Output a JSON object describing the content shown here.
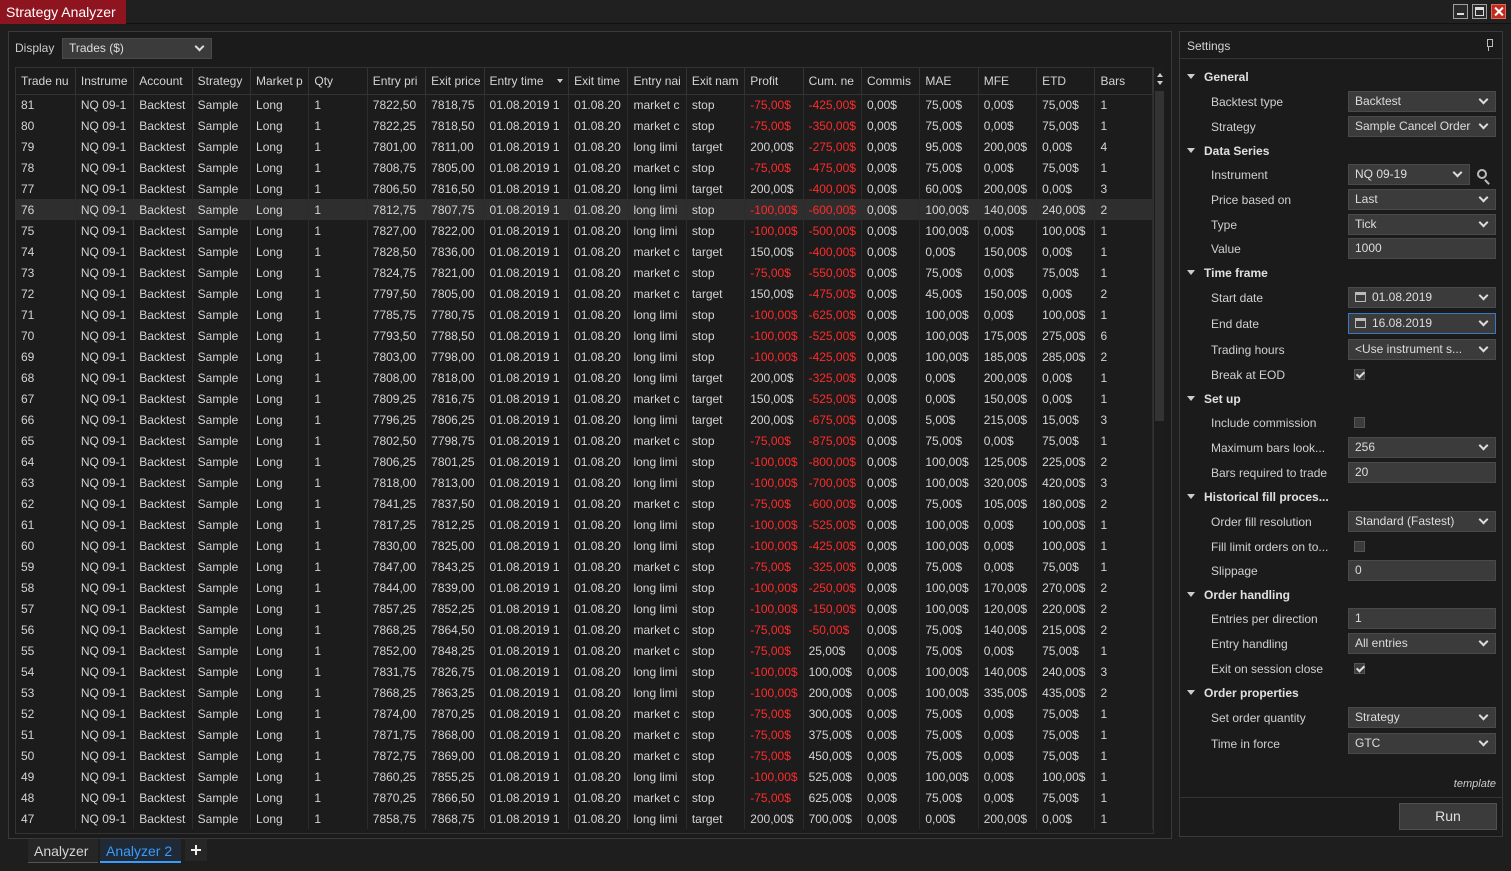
{
  "window": {
    "title": "Strategy Analyzer"
  },
  "toolbar": {
    "display_label": "Display",
    "display_value": "Trades ($)"
  },
  "grid": {
    "columns": [
      "Trade nu",
      "Instrume",
      "Account",
      "Strategy",
      "Market p",
      "Qty",
      "Entry pri",
      "Exit price",
      "Entry time",
      "Exit time",
      "Entry nai",
      "Exit nam",
      "Profit",
      "Cum. ne",
      "Commis",
      "MAE",
      "MFE",
      "ETD",
      "Bars"
    ],
    "rows": [
      [
        "81",
        "NQ 09-1",
        "Backtest",
        "Sample",
        "Long",
        "1",
        "7822,50",
        "7818,75",
        "01.08.2019 1",
        "01.08.20",
        "market c",
        "stop",
        "-75,00$",
        "-425,00$",
        "0,00$",
        "75,00$",
        "0,00$",
        "75,00$",
        "1"
      ],
      [
        "80",
        "NQ 09-1",
        "Backtest",
        "Sample",
        "Long",
        "1",
        "7822,25",
        "7818,50",
        "01.08.2019 1",
        "01.08.20",
        "market c",
        "stop",
        "-75,00$",
        "-350,00$",
        "0,00$",
        "75,00$",
        "0,00$",
        "75,00$",
        "1"
      ],
      [
        "79",
        "NQ 09-1",
        "Backtest",
        "Sample",
        "Long",
        "1",
        "7801,00",
        "7811,00",
        "01.08.2019 1",
        "01.08.20",
        "long limi",
        "target",
        "200,00$",
        "-275,00$",
        "0,00$",
        "95,00$",
        "200,00$",
        "0,00$",
        "4"
      ],
      [
        "78",
        "NQ 09-1",
        "Backtest",
        "Sample",
        "Long",
        "1",
        "7808,75",
        "7805,00",
        "01.08.2019 1",
        "01.08.20",
        "market c",
        "stop",
        "-75,00$",
        "-475,00$",
        "0,00$",
        "75,00$",
        "0,00$",
        "75,00$",
        "1"
      ],
      [
        "77",
        "NQ 09-1",
        "Backtest",
        "Sample",
        "Long",
        "1",
        "7806,50",
        "7816,50",
        "01.08.2019 1",
        "01.08.20",
        "long limi",
        "target",
        "200,00$",
        "-400,00$",
        "0,00$",
        "60,00$",
        "200,00$",
        "0,00$",
        "3"
      ],
      [
        "76",
        "NQ 09-1",
        "Backtest",
        "Sample",
        "Long",
        "1",
        "7812,75",
        "7807,75",
        "01.08.2019 1",
        "01.08.20",
        "long limi",
        "stop",
        "-100,00$",
        "-600,00$",
        "0,00$",
        "100,00$",
        "140,00$",
        "240,00$",
        "2"
      ],
      [
        "75",
        "NQ 09-1",
        "Backtest",
        "Sample",
        "Long",
        "1",
        "7827,00",
        "7822,00",
        "01.08.2019 1",
        "01.08.20",
        "long limi",
        "stop",
        "-100,00$",
        "-500,00$",
        "0,00$",
        "100,00$",
        "0,00$",
        "100,00$",
        "1"
      ],
      [
        "74",
        "NQ 09-1",
        "Backtest",
        "Sample",
        "Long",
        "1",
        "7828,50",
        "7836,00",
        "01.08.2019 1",
        "01.08.20",
        "market c",
        "target",
        "150,00$",
        "-400,00$",
        "0,00$",
        "0,00$",
        "150,00$",
        "0,00$",
        "1"
      ],
      [
        "73",
        "NQ 09-1",
        "Backtest",
        "Sample",
        "Long",
        "1",
        "7824,75",
        "7821,00",
        "01.08.2019 1",
        "01.08.20",
        "market c",
        "stop",
        "-75,00$",
        "-550,00$",
        "0,00$",
        "75,00$",
        "0,00$",
        "75,00$",
        "1"
      ],
      [
        "72",
        "NQ 09-1",
        "Backtest",
        "Sample",
        "Long",
        "1",
        "7797,50",
        "7805,00",
        "01.08.2019 1",
        "01.08.20",
        "market c",
        "target",
        "150,00$",
        "-475,00$",
        "0,00$",
        "45,00$",
        "150,00$",
        "0,00$",
        "2"
      ],
      [
        "71",
        "NQ 09-1",
        "Backtest",
        "Sample",
        "Long",
        "1",
        "7785,75",
        "7780,75",
        "01.08.2019 1",
        "01.08.20",
        "long limi",
        "stop",
        "-100,00$",
        "-625,00$",
        "0,00$",
        "100,00$",
        "0,00$",
        "100,00$",
        "1"
      ],
      [
        "70",
        "NQ 09-1",
        "Backtest",
        "Sample",
        "Long",
        "1",
        "7793,50",
        "7788,50",
        "01.08.2019 1",
        "01.08.20",
        "long limi",
        "stop",
        "-100,00$",
        "-525,00$",
        "0,00$",
        "100,00$",
        "175,00$",
        "275,00$",
        "6"
      ],
      [
        "69",
        "NQ 09-1",
        "Backtest",
        "Sample",
        "Long",
        "1",
        "7803,00",
        "7798,00",
        "01.08.2019 1",
        "01.08.20",
        "long limi",
        "stop",
        "-100,00$",
        "-425,00$",
        "0,00$",
        "100,00$",
        "185,00$",
        "285,00$",
        "2"
      ],
      [
        "68",
        "NQ 09-1",
        "Backtest",
        "Sample",
        "Long",
        "1",
        "7808,00",
        "7818,00",
        "01.08.2019 1",
        "01.08.20",
        "long limi",
        "target",
        "200,00$",
        "-325,00$",
        "0,00$",
        "0,00$",
        "200,00$",
        "0,00$",
        "1"
      ],
      [
        "67",
        "NQ 09-1",
        "Backtest",
        "Sample",
        "Long",
        "1",
        "7809,25",
        "7816,75",
        "01.08.2019 1",
        "01.08.20",
        "market c",
        "target",
        "150,00$",
        "-525,00$",
        "0,00$",
        "0,00$",
        "150,00$",
        "0,00$",
        "1"
      ],
      [
        "66",
        "NQ 09-1",
        "Backtest",
        "Sample",
        "Long",
        "1",
        "7796,25",
        "7806,25",
        "01.08.2019 1",
        "01.08.20",
        "long limi",
        "target",
        "200,00$",
        "-675,00$",
        "0,00$",
        "5,00$",
        "215,00$",
        "15,00$",
        "3"
      ],
      [
        "65",
        "NQ 09-1",
        "Backtest",
        "Sample",
        "Long",
        "1",
        "7802,50",
        "7798,75",
        "01.08.2019 1",
        "01.08.20",
        "market c",
        "stop",
        "-75,00$",
        "-875,00$",
        "0,00$",
        "75,00$",
        "0,00$",
        "75,00$",
        "1"
      ],
      [
        "64",
        "NQ 09-1",
        "Backtest",
        "Sample",
        "Long",
        "1",
        "7806,25",
        "7801,25",
        "01.08.2019 1",
        "01.08.20",
        "long limi",
        "stop",
        "-100,00$",
        "-800,00$",
        "0,00$",
        "100,00$",
        "125,00$",
        "225,00$",
        "2"
      ],
      [
        "63",
        "NQ 09-1",
        "Backtest",
        "Sample",
        "Long",
        "1",
        "7818,00",
        "7813,00",
        "01.08.2019 1",
        "01.08.20",
        "long limi",
        "stop",
        "-100,00$",
        "-700,00$",
        "0,00$",
        "100,00$",
        "320,00$",
        "420,00$",
        "3"
      ],
      [
        "62",
        "NQ 09-1",
        "Backtest",
        "Sample",
        "Long",
        "1",
        "7841,25",
        "7837,50",
        "01.08.2019 1",
        "01.08.20",
        "market c",
        "stop",
        "-75,00$",
        "-600,00$",
        "0,00$",
        "75,00$",
        "105,00$",
        "180,00$",
        "2"
      ],
      [
        "61",
        "NQ 09-1",
        "Backtest",
        "Sample",
        "Long",
        "1",
        "7817,25",
        "7812,25",
        "01.08.2019 1",
        "01.08.20",
        "long limi",
        "stop",
        "-100,00$",
        "-525,00$",
        "0,00$",
        "100,00$",
        "0,00$",
        "100,00$",
        "1"
      ],
      [
        "60",
        "NQ 09-1",
        "Backtest",
        "Sample",
        "Long",
        "1",
        "7830,00",
        "7825,00",
        "01.08.2019 1",
        "01.08.20",
        "long limi",
        "stop",
        "-100,00$",
        "-425,00$",
        "0,00$",
        "100,00$",
        "0,00$",
        "100,00$",
        "1"
      ],
      [
        "59",
        "NQ 09-1",
        "Backtest",
        "Sample",
        "Long",
        "1",
        "7847,00",
        "7843,25",
        "01.08.2019 1",
        "01.08.20",
        "market c",
        "stop",
        "-75,00$",
        "-325,00$",
        "0,00$",
        "75,00$",
        "0,00$",
        "75,00$",
        "1"
      ],
      [
        "58",
        "NQ 09-1",
        "Backtest",
        "Sample",
        "Long",
        "1",
        "7844,00",
        "7839,00",
        "01.08.2019 1",
        "01.08.20",
        "long limi",
        "stop",
        "-100,00$",
        "-250,00$",
        "0,00$",
        "100,00$",
        "170,00$",
        "270,00$",
        "2"
      ],
      [
        "57",
        "NQ 09-1",
        "Backtest",
        "Sample",
        "Long",
        "1",
        "7857,25",
        "7852,25",
        "01.08.2019 1",
        "01.08.20",
        "long limi",
        "stop",
        "-100,00$",
        "-150,00$",
        "0,00$",
        "100,00$",
        "120,00$",
        "220,00$",
        "2"
      ],
      [
        "56",
        "NQ 09-1",
        "Backtest",
        "Sample",
        "Long",
        "1",
        "7868,25",
        "7864,50",
        "01.08.2019 1",
        "01.08.20",
        "market c",
        "stop",
        "-75,00$",
        "-50,00$",
        "0,00$",
        "75,00$",
        "140,00$",
        "215,00$",
        "2"
      ],
      [
        "55",
        "NQ 09-1",
        "Backtest",
        "Sample",
        "Long",
        "1",
        "7852,00",
        "7848,25",
        "01.08.2019 1",
        "01.08.20",
        "market c",
        "stop",
        "-75,00$",
        "25,00$",
        "0,00$",
        "75,00$",
        "0,00$",
        "75,00$",
        "1"
      ],
      [
        "54",
        "NQ 09-1",
        "Backtest",
        "Sample",
        "Long",
        "1",
        "7831,75",
        "7826,75",
        "01.08.2019 1",
        "01.08.20",
        "long limi",
        "stop",
        "-100,00$",
        "100,00$",
        "0,00$",
        "100,00$",
        "140,00$",
        "240,00$",
        "3"
      ],
      [
        "53",
        "NQ 09-1",
        "Backtest",
        "Sample",
        "Long",
        "1",
        "7868,25",
        "7863,25",
        "01.08.2019 1",
        "01.08.20",
        "long limi",
        "stop",
        "-100,00$",
        "200,00$",
        "0,00$",
        "100,00$",
        "335,00$",
        "435,00$",
        "2"
      ],
      [
        "52",
        "NQ 09-1",
        "Backtest",
        "Sample",
        "Long",
        "1",
        "7874,00",
        "7870,25",
        "01.08.2019 1",
        "01.08.20",
        "market c",
        "stop",
        "-75,00$",
        "300,00$",
        "0,00$",
        "75,00$",
        "0,00$",
        "75,00$",
        "1"
      ],
      [
        "51",
        "NQ 09-1",
        "Backtest",
        "Sample",
        "Long",
        "1",
        "7871,75",
        "7868,00",
        "01.08.2019 1",
        "01.08.20",
        "market c",
        "stop",
        "-75,00$",
        "375,00$",
        "0,00$",
        "75,00$",
        "0,00$",
        "75,00$",
        "1"
      ],
      [
        "50",
        "NQ 09-1",
        "Backtest",
        "Sample",
        "Long",
        "1",
        "7872,75",
        "7869,00",
        "01.08.2019 1",
        "01.08.20",
        "market c",
        "stop",
        "-75,00$",
        "450,00$",
        "0,00$",
        "75,00$",
        "0,00$",
        "75,00$",
        "1"
      ],
      [
        "49",
        "NQ 09-1",
        "Backtest",
        "Sample",
        "Long",
        "1",
        "7860,25",
        "7855,25",
        "01.08.2019 1",
        "01.08.20",
        "long limi",
        "stop",
        "-100,00$",
        "525,00$",
        "0,00$",
        "100,00$",
        "0,00$",
        "100,00$",
        "1"
      ],
      [
        "48",
        "NQ 09-1",
        "Backtest",
        "Sample",
        "Long",
        "1",
        "7870,25",
        "7866,50",
        "01.08.2019 1",
        "01.08.20",
        "market c",
        "stop",
        "-75,00$",
        "625,00$",
        "0,00$",
        "75,00$",
        "0,00$",
        "75,00$",
        "1"
      ],
      [
        "47",
        "NQ 09-1",
        "Backtest",
        "Sample",
        "Long",
        "1",
        "7858,75",
        "7868,75",
        "01.08.2019 1",
        "01.08.20",
        "long limi",
        "target",
        "200,00$",
        "700,00$",
        "0,00$",
        "0,00$",
        "200,00$",
        "0,00$",
        "1"
      ]
    ]
  },
  "settings": {
    "title": "Settings",
    "categories": {
      "general": "General",
      "data_series": "Data Series",
      "time_frame": "Time frame",
      "setup": "Set up",
      "historical": "Historical fill proces...",
      "order_handling": "Order handling",
      "order_properties": "Order properties"
    },
    "labels": {
      "backtest_type": "Backtest type",
      "strategy": "Strategy",
      "instrument": "Instrument",
      "price_based_on": "Price based on",
      "type": "Type",
      "value": "Value",
      "start_date": "Start date",
      "end_date": "End date",
      "trading_hours": "Trading hours",
      "break_at_eod": "Break at EOD",
      "include_commission": "Include commission",
      "max_bars_lookback": "Maximum bars look...",
      "bars_required": "Bars required to trade",
      "order_fill_resolution": "Order fill resolution",
      "fill_limit_orders": "Fill limit orders on to...",
      "slippage": "Slippage",
      "entries_per_direction": "Entries per direction",
      "entry_handling": "Entry handling",
      "exit_on_session_close": "Exit on session close",
      "set_order_quantity": "Set order quantity",
      "time_in_force": "Time in force"
    },
    "values": {
      "backtest_type": "Backtest",
      "strategy": "Sample Cancel Order",
      "instrument": "NQ 09-19",
      "price_based_on": "Last",
      "type": "Tick",
      "value": "1000",
      "start_date": "01.08.2019",
      "end_date": "16.08.2019",
      "trading_hours": "<Use instrument s...",
      "max_bars_lookback": "256",
      "bars_required": "20",
      "order_fill_resolution": "Standard (Fastest)",
      "slippage": "0",
      "entries_per_direction": "1",
      "entry_handling": "All entries",
      "set_order_quantity": "Strategy",
      "time_in_force": "GTC"
    },
    "checks": {
      "break_at_eod": true,
      "include_commission": false,
      "fill_limit_orders": false,
      "exit_on_session_close": true
    },
    "template_label": "template",
    "run_label": "Run"
  },
  "tabs": {
    "analyzer": "Analyzer",
    "analyzer2": "Analyzer 2"
  },
  "colors": {
    "accent": "#3a9bff",
    "title_bg": "#8e1520",
    "negative": "#ff2b2b"
  }
}
